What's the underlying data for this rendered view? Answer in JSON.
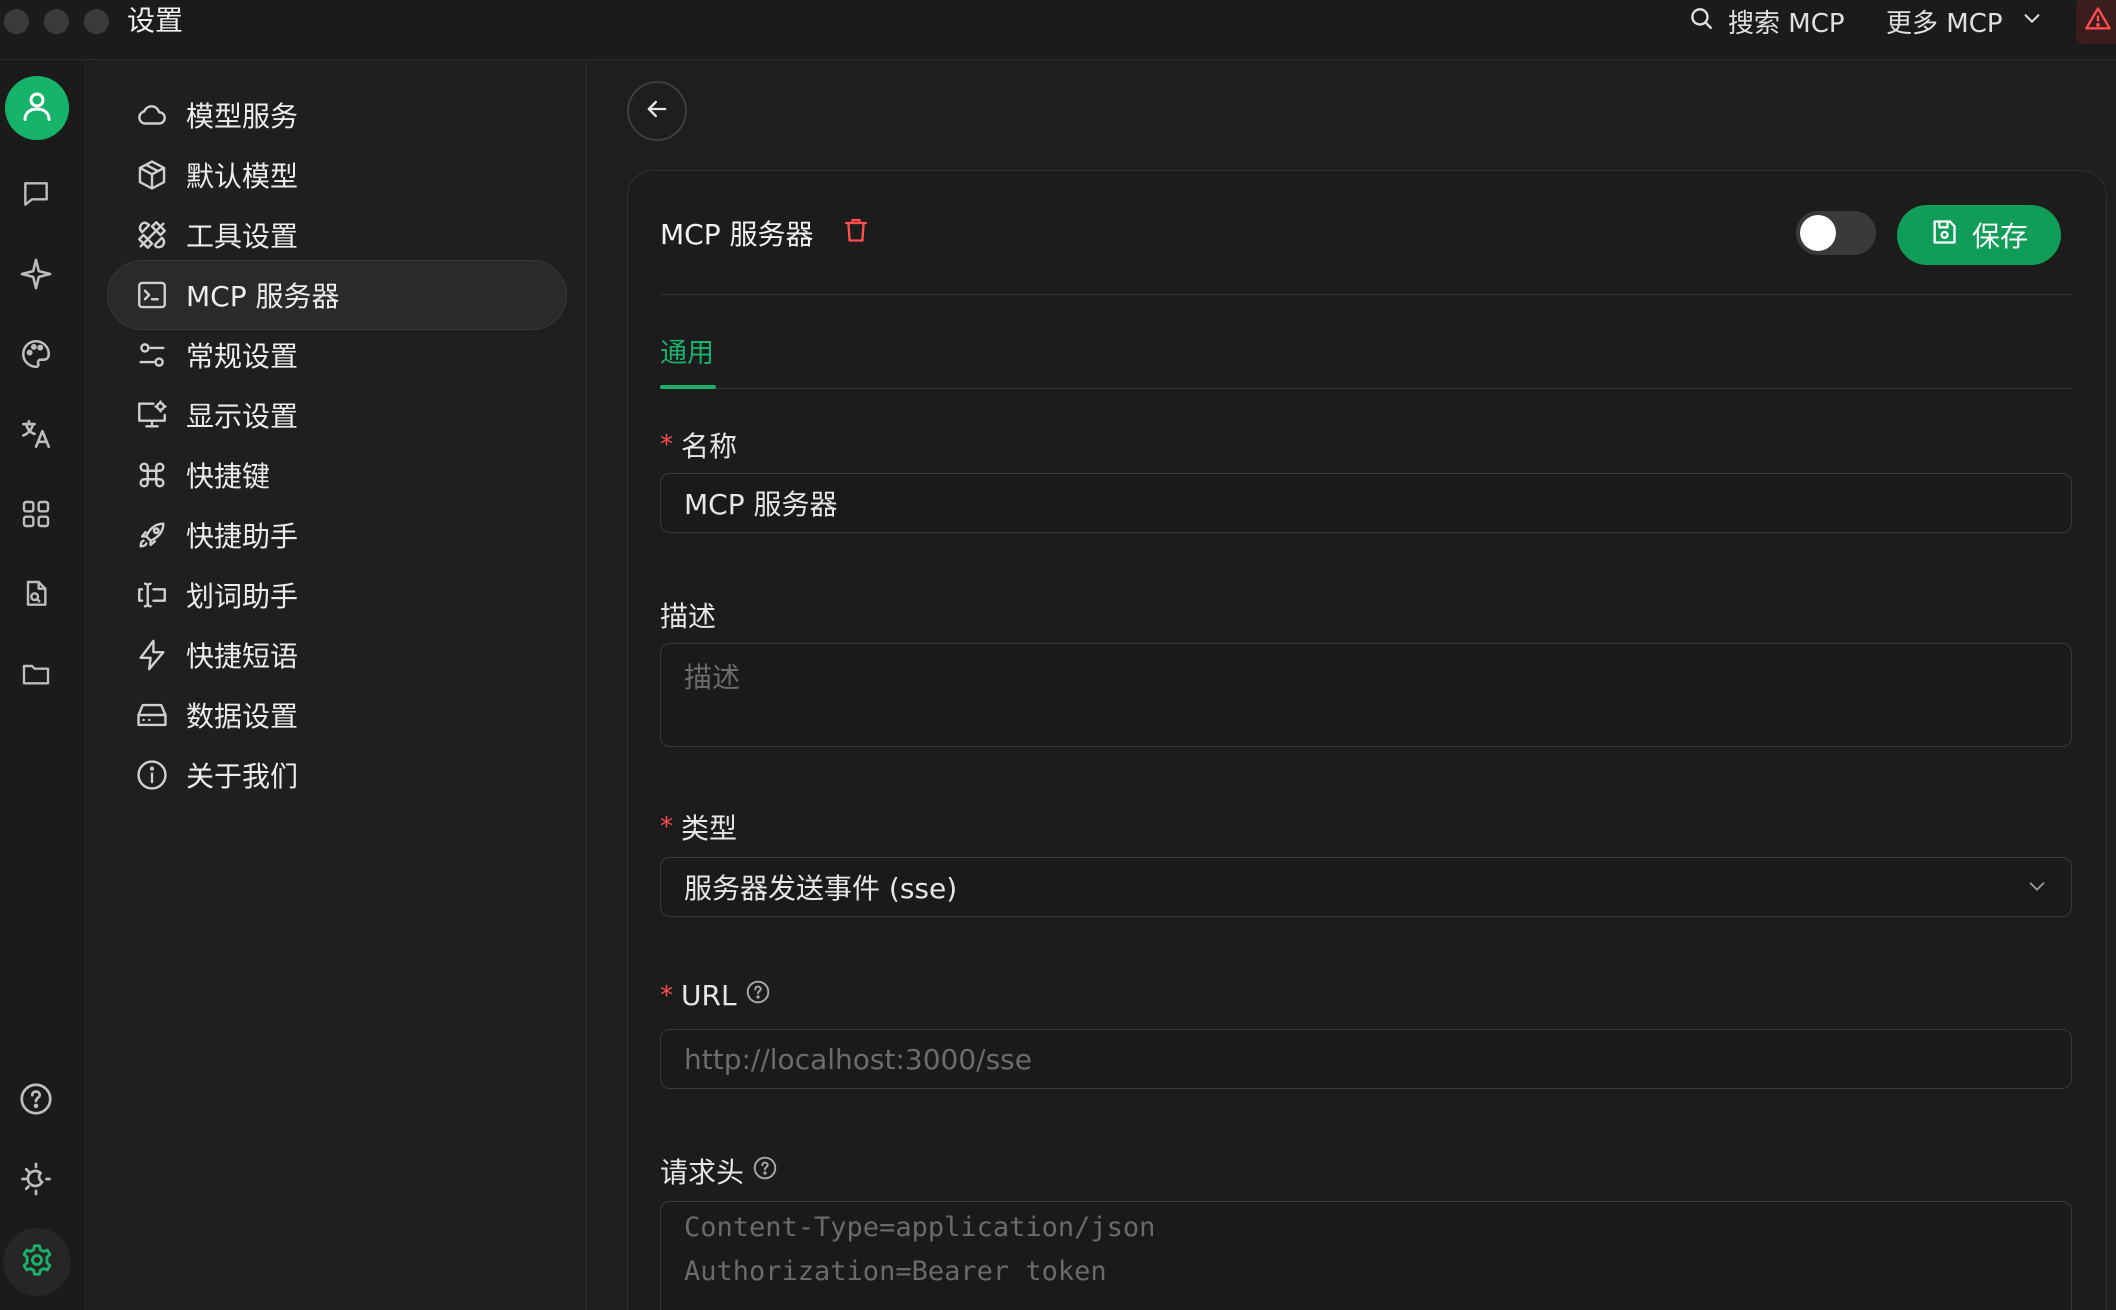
{
  "window": {
    "title": "设置"
  },
  "toolbar": {
    "search_label": "搜索 MCP",
    "more_label": "更多 MCP"
  },
  "rail": {
    "items": [
      "user-icon",
      "chat-icon",
      "sparkle-icon",
      "palette-icon",
      "translate-icon",
      "apps-icon",
      "document-search-icon",
      "folder-icon",
      "help-icon",
      "theme-icon",
      "settings-icon"
    ],
    "active": "settings-icon"
  },
  "menu": {
    "items": [
      {
        "label": "模型服务",
        "icon": "cloud-icon"
      },
      {
        "label": "默认模型",
        "icon": "cube-icon"
      },
      {
        "label": "工具设置",
        "icon": "tools-icon"
      },
      {
        "label": "MCP 服务器",
        "icon": "terminal-icon"
      },
      {
        "label": "常规设置",
        "icon": "sliders-icon"
      },
      {
        "label": "显示设置",
        "icon": "monitor-settings-icon"
      },
      {
        "label": "快捷键",
        "icon": "command-icon"
      },
      {
        "label": "快捷助手",
        "icon": "rocket-icon"
      },
      {
        "label": "划词助手",
        "icon": "text-cursor-icon"
      },
      {
        "label": "快捷短语",
        "icon": "zap-icon"
      },
      {
        "label": "数据设置",
        "icon": "storage-icon"
      },
      {
        "label": "关于我们",
        "icon": "info-icon"
      }
    ],
    "active_index": 3
  },
  "server": {
    "title": "MCP 服务器",
    "enabled": false,
    "save_label": "保存",
    "tabs": [
      "通用"
    ],
    "active_tab": "通用",
    "fields": {
      "name": {
        "label": "名称",
        "required": true,
        "value": "MCP 服务器"
      },
      "description": {
        "label": "描述",
        "required": false,
        "placeholder": "描述"
      },
      "type": {
        "label": "类型",
        "required": true,
        "value": "服务器发送事件 (sse)"
      },
      "url": {
        "label": "URL",
        "required": true,
        "placeholder": "http://localhost:3000/sse"
      },
      "headers": {
        "label": "请求头",
        "required": false,
        "placeholder_lines": [
          "Content-Type=application/json",
          "Authorization=Bearer token"
        ]
      }
    }
  },
  "colors": {
    "accent": "#0f9d58",
    "required_mark": "#ff4d4f",
    "warning": "#ff4d4f"
  }
}
